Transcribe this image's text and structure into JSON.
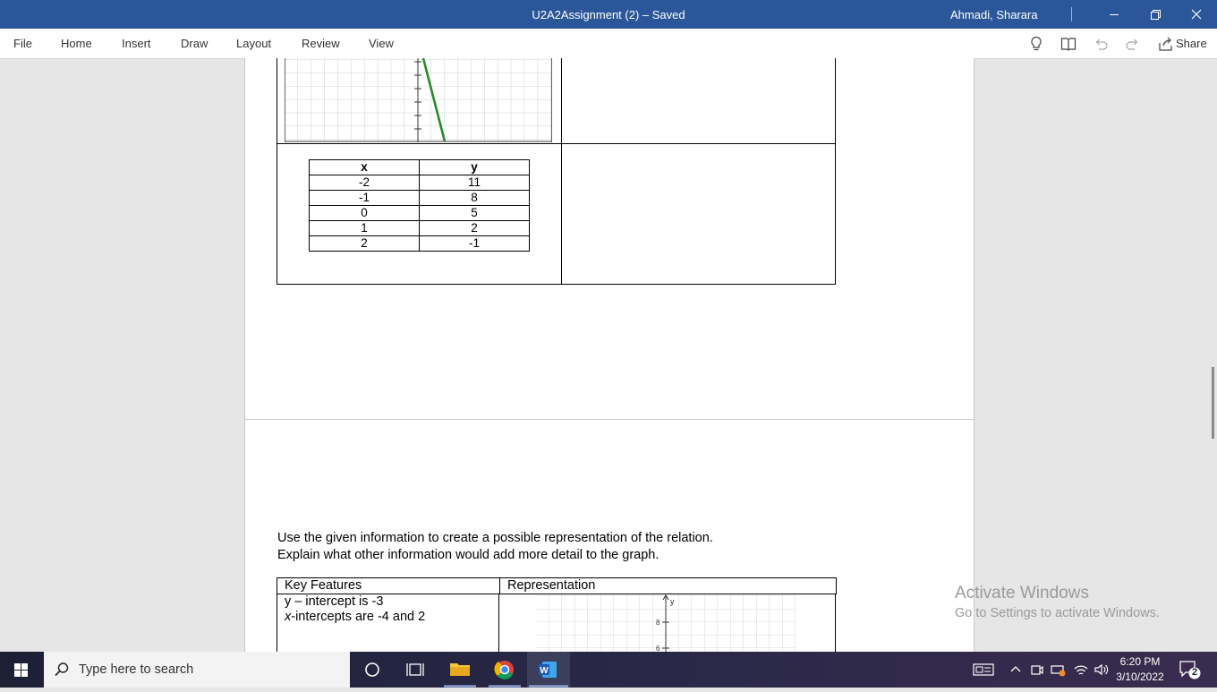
{
  "window": {
    "title": "U2A2Assignment (2) – Saved",
    "user": "Ahmadi, Sharara"
  },
  "ribbon": {
    "tabs": [
      "File",
      "Home",
      "Insert",
      "Draw",
      "Layout",
      "Review",
      "View"
    ],
    "share_label": "Share",
    "icons": [
      "lightbulb-icon",
      "reading-view-icon",
      "undo-icon",
      "redo-icon",
      "share-icon"
    ]
  },
  "document": {
    "xy_table": {
      "headers": [
        "x",
        "y"
      ],
      "rows": [
        [
          "-2",
          "11"
        ],
        [
          "-1",
          "8"
        ],
        [
          "0",
          "5"
        ],
        [
          "1",
          "2"
        ],
        [
          "2",
          "-1"
        ]
      ]
    },
    "instructions": [
      "Use the given information to create a possible representation of the relation.",
      "Explain what other information would add more detail to the graph."
    ],
    "key_features_table": {
      "headers": [
        "Key Features",
        "Representation"
      ],
      "features": [
        "y – intercept is -3",
        "-intercepts are -4 and 2"
      ],
      "feature_italic_prefix": "x",
      "graph_labels": {
        "y_axis": "y",
        "tick_8": "8",
        "tick_6": "6"
      }
    },
    "line_color": "#2a8a2a"
  },
  "watermark": {
    "line1": "Activate Windows",
    "line2": "Go to Settings to activate Windows."
  },
  "taskbar": {
    "search_placeholder": "Type here to search",
    "time": "6:20 PM",
    "date": "3/10/2022",
    "notification_count": "2",
    "apps": [
      "start-icon",
      "cortana-icon",
      "task-view-icon",
      "file-explorer-icon",
      "chrome-icon",
      "word-icon"
    ]
  }
}
